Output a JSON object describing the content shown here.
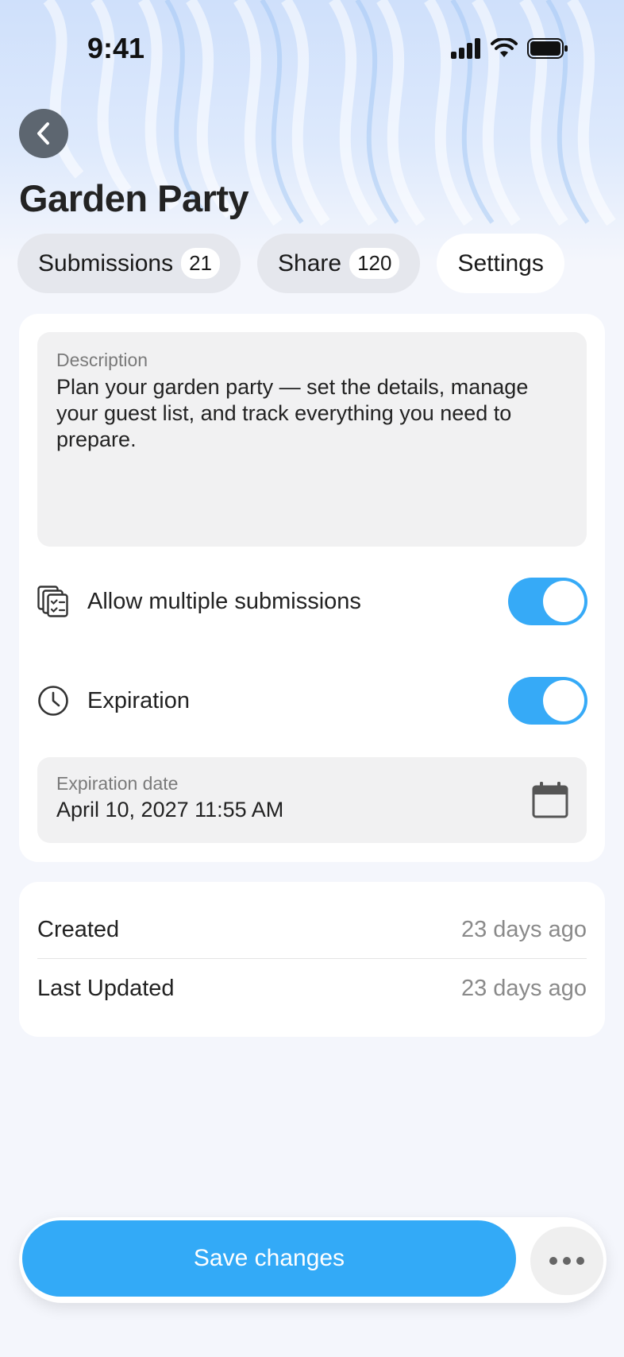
{
  "status_bar": {
    "time": "9:41"
  },
  "header": {
    "title": "Garden Party"
  },
  "tabs": [
    {
      "label": "Submissions",
      "count": "21"
    },
    {
      "label": "Share",
      "count": "120"
    },
    {
      "label": "Settings"
    }
  ],
  "settings": {
    "description_label": "Description",
    "description_text": "Plan your garden party — set the details, manage your guest list, and track everything you need to prepare.",
    "allow_multiple_label": "Allow multiple submissions",
    "allow_multiple_enabled": true,
    "expiration_label": "Expiration",
    "expiration_enabled": true,
    "expiration_date_label": "Expiration date",
    "expiration_date_value": "April 10, 2027 11:55 AM"
  },
  "meta": {
    "created_label": "Created",
    "created_value": "23 days ago",
    "updated_label": "Last Updated",
    "updated_value": "23 days ago"
  },
  "actions": {
    "save_label": "Save changes"
  },
  "colors": {
    "accent": "#33aaf7",
    "toggle_on": "#36aaf7",
    "back_button": "#5d6670"
  },
  "icons": [
    "back-chevron-icon",
    "signal-icon",
    "wifi-icon",
    "battery-icon",
    "multiple-documents-icon",
    "clock-icon",
    "calendar-icon",
    "more-dots-icon"
  ]
}
